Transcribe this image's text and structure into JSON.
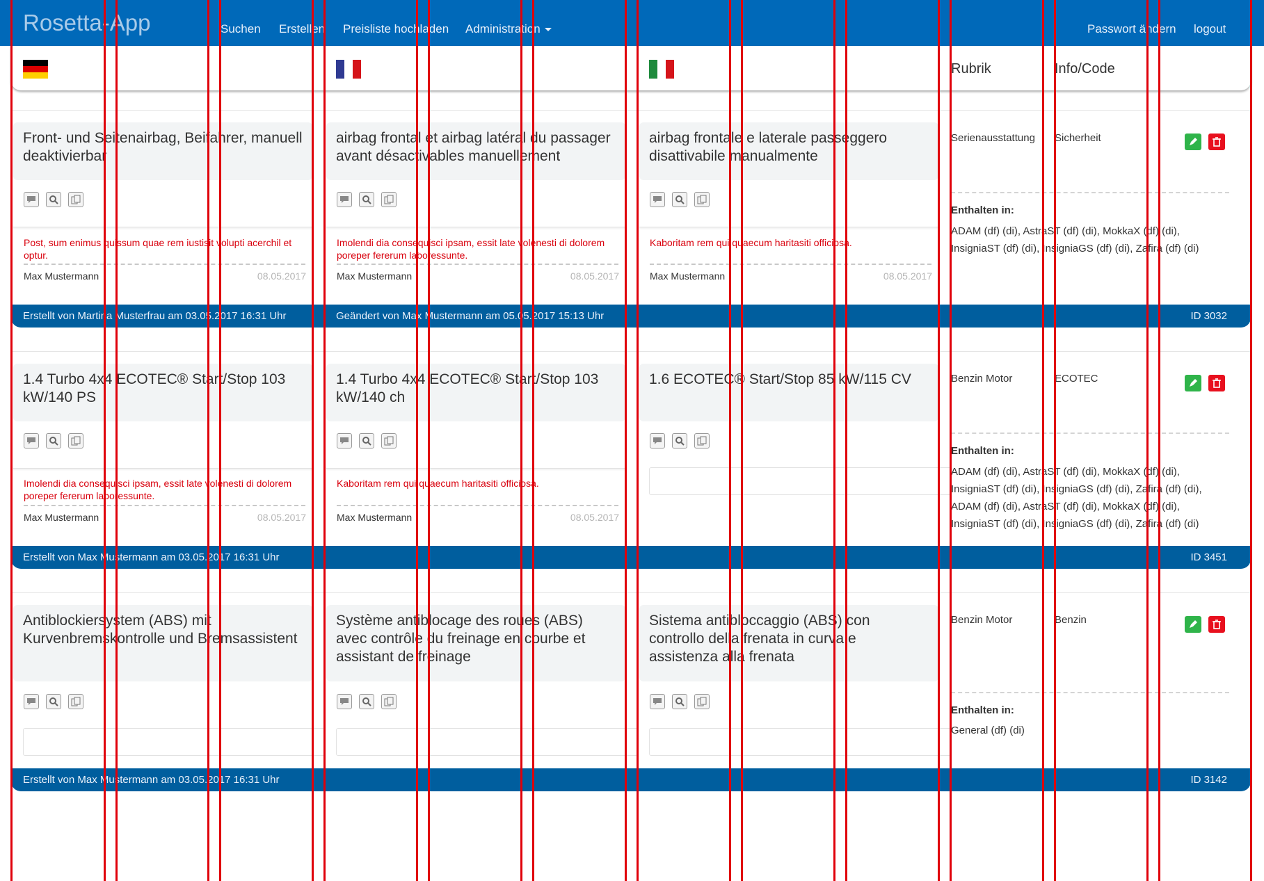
{
  "navbar": {
    "brand": "Rosetta-App",
    "items": [
      "Suchen",
      "Erstellen",
      "Preisliste hochladen",
      "Administration"
    ],
    "right_items": [
      "Passwort ändern",
      "logout"
    ]
  },
  "header": {
    "flags": [
      "german-flag",
      "french-flag",
      "italian-flag"
    ],
    "columns": [
      "Rubrik",
      "Info/Code"
    ]
  },
  "entries": [
    {
      "texts": [
        "Front- und Seitenairbag, Beifahrer, manuell deaktivierbar",
        "airbag frontal et airbag latéral du passager avant désactivables manuellement",
        "airbag frontale e laterale passeggero disattivabile manualmente"
      ],
      "comments": [
        {
          "text": "Post, sum enimus quissum quae rem iustisit volupti acerchil et optur.",
          "author": "Max Mustermann",
          "date": "08.05.2017"
        },
        {
          "text": "Imolendi dia consequisci ipsam, essit late volenesti di dolorem poreper fererum laboressunte.",
          "author": "Max Mustermann",
          "date": "08.05.2017"
        },
        {
          "text": "Kaboritam rem qui quaecum haritasiti officiosa.",
          "author": "Max Mustermann",
          "date": "08.05.2017"
        }
      ],
      "rubrik": "Serienausstattung",
      "info": "Sicherheit",
      "enthalten_label": "Enthalten in:",
      "enthalten": "ADAM (df) (di), AstraST (df) (di), MokkaX (df) (di), InsigniaST (df) (di), InsigniaGS (df) (di), Zafira (df) (di)",
      "footer_left": [
        "Erstellt von Martina Musterfrau am 03.05.2017 16:31 Uhr",
        "Geändert von Max Mustermann am 05.05.2017 15:13 Uhr"
      ],
      "footer_id": "ID 3032"
    },
    {
      "texts": [
        "1.4 Turbo 4x4 ECOTEC® Start/Stop 103 kW/140 PS",
        "1.4 Turbo 4x4 ECOTEC® Start/Stop 103 kW/140 ch",
        "1.6 ECOTEC® Start/Stop 85 kW/115 CV"
      ],
      "comments": [
        {
          "text": "Imolendi dia consequisci ipsam, essit late volenesti di dolorem poreper fererum laboressunte.",
          "author": "Max Mustermann",
          "date": "08.05.2017"
        },
        {
          "text": "Kaboritam rem qui quaecum haritasiti officiosa.",
          "author": "Max Mustermann",
          "date": "08.05.2017"
        }
      ],
      "rubrik": "Benzin Motor",
      "info": "ECOTEC",
      "enthalten_label": "Enthalten in:",
      "enthalten": "ADAM (df) (di), AstraST (df) (di), MokkaX (df) (di), InsigniaST (df) (di), InsigniaGS (df) (di), Zafira (df) (di), ADAM (df) (di), AstraST (df) (di), MokkaX (df) (di), InsigniaST (df) (di), InsigniaGS (df) (di), Zafira (df) (di)",
      "footer_left": [
        "Erstellt von Max Mustermann am 03.05.2017 16:31 Uhr"
      ],
      "footer_id": "ID 3451"
    },
    {
      "texts": [
        "Antiblockiersystem (ABS) mit Kurvenbremskontrolle und Bremsassistent",
        "Système antiblocage des roues (ABS) avec contrôle du freinage en courbe et assistant de freinage",
        "Sistema antibloccaggio (ABS) con controllo della frenata in curva e assistenza alla frenata"
      ],
      "comments": [],
      "rubrik": "Benzin Motor",
      "info": "Benzin",
      "enthalten_label": "Enthalten in:",
      "enthalten": "General (df) (di)",
      "footer_left": [
        "Erstellt von Max Mustermann am 03.05.2017 16:31 Uhr"
      ],
      "footer_id": "ID 3142"
    }
  ],
  "icons": [
    "comment-icon",
    "search-icon",
    "copy-icon",
    "edit-icon",
    "delete-icon"
  ],
  "colors": {
    "navbar": "#0069b9",
    "footer": "#005e9e",
    "comment_text": "#d9000d",
    "edit": "#2fb44a",
    "delete": "#e8101e",
    "guide_lines": "#e0000a"
  }
}
